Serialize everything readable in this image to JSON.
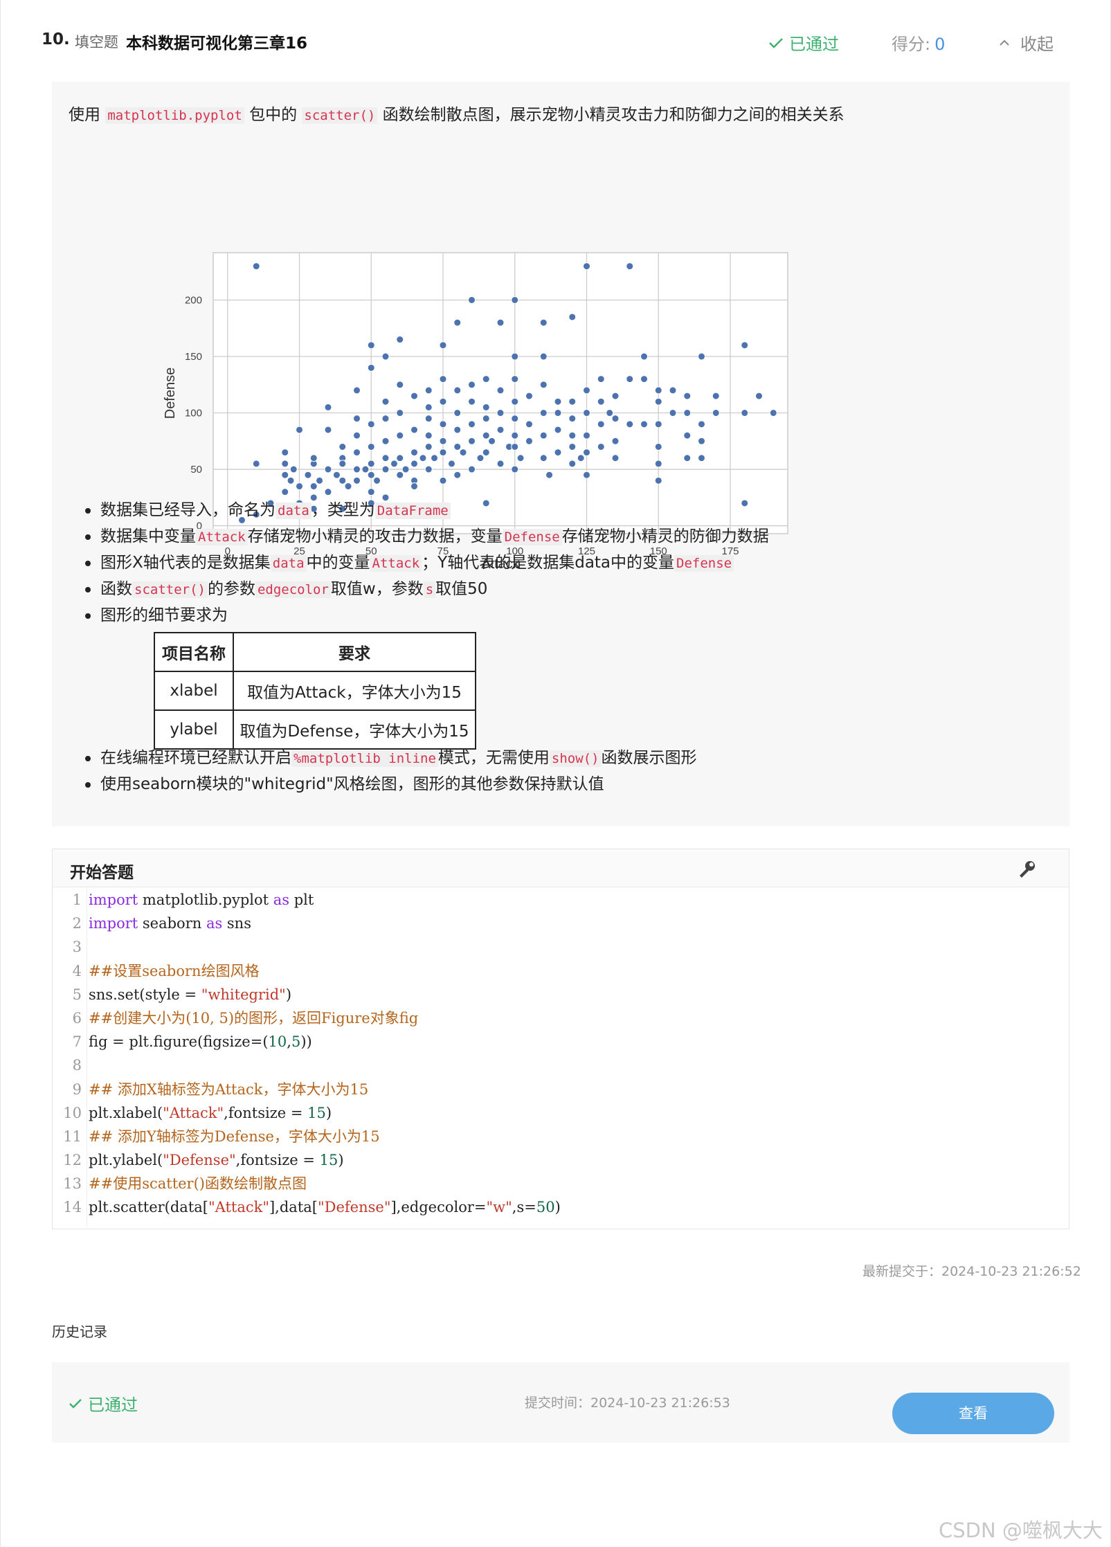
{
  "header": {
    "number": "10.",
    "type": "填空题",
    "title": "本科数据可视化第三章16",
    "status": "已通过",
    "score_label": "得分:",
    "score_value": "0",
    "collapse_label": "收起"
  },
  "description": {
    "intro": {
      "p1": "使用",
      "c1": "matplotlib.pyplot",
      "p2": "包中的",
      "c2": "scatter()",
      "p3": "函数绘制散点图，展示宠物小精灵攻击力和防御力之间的相关关系"
    },
    "bullets": [
      {
        "p1": "数据集已经导入，命名为",
        "c1": "data",
        "p2": "，类型为",
        "c2": "DataFrame"
      },
      {
        "p1": "数据集中变量",
        "c1": "Attack",
        "p2": "存储宠物小精灵的攻击力数据，变量",
        "c2": "Defense",
        "p3": "存储宠物小精灵的防御力数据"
      },
      {
        "p1": "图形X轴代表的是数据集",
        "c1": "data",
        "p2": "中的变量",
        "c2": "Attack",
        "p3": "；Y轴代表的是数据集data中的变量",
        "c3": "Defense"
      },
      {
        "p1": "函数",
        "c1": "scatter()",
        "p2": "的参数",
        "c2": "edgecolor",
        "p3": "取值w，参数",
        "c3": "s",
        "p4": "取值50"
      },
      {
        "p1": "图形的细节要求为"
      }
    ],
    "table": {
      "headers": [
        "项目名称",
        "要求"
      ],
      "rows": [
        [
          "xlabel",
          "取值为Attack，字体大小为15"
        ],
        [
          "ylabel",
          "取值为Defense，字体大小为15"
        ]
      ]
    },
    "bullets2": [
      {
        "p1": "在线编程环境已经默认开启",
        "c1": "%matplotlib inline",
        "p2": "模式，无需使用",
        "c2": "show()",
        "p3": "函数展示图形"
      },
      {
        "p1": "使用seaborn模块的\"whitegrid\"风格绘图，图形的其他参数保持默认值"
      }
    ]
  },
  "chart_data": {
    "type": "scatter",
    "xlabel": "Attack",
    "ylabel": "Defense",
    "xlim": [
      -5,
      195
    ],
    "ylim": [
      -7,
      242
    ],
    "xticks": [
      0,
      25,
      50,
      75,
      100,
      125,
      150,
      175
    ],
    "yticks": [
      0,
      50,
      100,
      150,
      200
    ],
    "grid": true,
    "marker_color": "#4c72b0",
    "edge_color": "#ffffff",
    "points": [
      [
        5,
        5
      ],
      [
        10,
        10
      ],
      [
        10,
        55
      ],
      [
        10,
        230
      ],
      [
        15,
        20
      ],
      [
        20,
        15
      ],
      [
        20,
        30
      ],
      [
        20,
        45
      ],
      [
        20,
        55
      ],
      [
        20,
        65
      ],
      [
        22,
        40
      ],
      [
        23,
        50
      ],
      [
        25,
        35
      ],
      [
        25,
        85
      ],
      [
        25,
        20
      ],
      [
        28,
        45
      ],
      [
        30,
        35
      ],
      [
        30,
        55
      ],
      [
        30,
        60
      ],
      [
        30,
        25
      ],
      [
        30,
        15
      ],
      [
        32,
        40
      ],
      [
        35,
        50
      ],
      [
        35,
        85
      ],
      [
        35,
        30
      ],
      [
        35,
        105
      ],
      [
        38,
        45
      ],
      [
        40,
        40
      ],
      [
        40,
        60
      ],
      [
        40,
        70
      ],
      [
        40,
        15
      ],
      [
        40,
        55
      ],
      [
        42,
        35
      ],
      [
        45,
        40
      ],
      [
        45,
        50
      ],
      [
        45,
        65
      ],
      [
        45,
        80
      ],
      [
        45,
        95
      ],
      [
        45,
        120
      ],
      [
        48,
        50
      ],
      [
        50,
        30
      ],
      [
        50,
        45
      ],
      [
        50,
        55
      ],
      [
        50,
        70
      ],
      [
        50,
        90
      ],
      [
        50,
        160
      ],
      [
        50,
        140
      ],
      [
        50,
        20
      ],
      [
        52,
        40
      ],
      [
        55,
        50
      ],
      [
        55,
        60
      ],
      [
        55,
        75
      ],
      [
        55,
        95
      ],
      [
        55,
        110
      ],
      [
        55,
        150
      ],
      [
        55,
        25
      ],
      [
        58,
        55
      ],
      [
        60,
        45
      ],
      [
        60,
        60
      ],
      [
        60,
        80
      ],
      [
        60,
        100
      ],
      [
        60,
        125
      ],
      [
        60,
        165
      ],
      [
        62,
        50
      ],
      [
        65,
        40
      ],
      [
        65,
        55
      ],
      [
        65,
        65
      ],
      [
        65,
        85
      ],
      [
        65,
        115
      ],
      [
        65,
        35
      ],
      [
        68,
        60
      ],
      [
        70,
        50
      ],
      [
        70,
        70
      ],
      [
        70,
        80
      ],
      [
        70,
        95
      ],
      [
        70,
        105
      ],
      [
        70,
        120
      ],
      [
        72,
        60
      ],
      [
        75,
        40
      ],
      [
        75,
        65
      ],
      [
        75,
        75
      ],
      [
        75,
        90
      ],
      [
        75,
        110
      ],
      [
        75,
        130
      ],
      [
        75,
        160
      ],
      [
        78,
        55
      ],
      [
        80,
        45
      ],
      [
        80,
        70
      ],
      [
        80,
        85
      ],
      [
        80,
        100
      ],
      [
        80,
        120
      ],
      [
        80,
        180
      ],
      [
        82,
        65
      ],
      [
        85,
        50
      ],
      [
        85,
        75
      ],
      [
        85,
        90
      ],
      [
        85,
        110
      ],
      [
        85,
        125
      ],
      [
        85,
        200
      ],
      [
        88,
        60
      ],
      [
        90,
        65
      ],
      [
        90,
        80
      ],
      [
        90,
        95
      ],
      [
        90,
        105
      ],
      [
        90,
        130
      ],
      [
        90,
        20
      ],
      [
        92,
        75
      ],
      [
        95,
        55
      ],
      [
        95,
        85
      ],
      [
        95,
        100
      ],
      [
        95,
        120
      ],
      [
        95,
        180
      ],
      [
        98,
        70
      ],
      [
        100,
        50
      ],
      [
        100,
        70
      ],
      [
        100,
        80
      ],
      [
        100,
        95
      ],
      [
        100,
        110
      ],
      [
        100,
        130
      ],
      [
        100,
        150
      ],
      [
        100,
        200
      ],
      [
        102,
        60
      ],
      [
        105,
        75
      ],
      [
        105,
        90
      ],
      [
        105,
        115
      ],
      [
        110,
        60
      ],
      [
        110,
        80
      ],
      [
        110,
        100
      ],
      [
        110,
        125
      ],
      [
        110,
        150
      ],
      [
        110,
        180
      ],
      [
        112,
        45
      ],
      [
        115,
        65
      ],
      [
        115,
        85
      ],
      [
        115,
        100
      ],
      [
        115,
        110
      ],
      [
        120,
        55
      ],
      [
        120,
        70
      ],
      [
        120,
        80
      ],
      [
        120,
        95
      ],
      [
        120,
        110
      ],
      [
        120,
        185
      ],
      [
        123,
        60
      ],
      [
        125,
        45
      ],
      [
        125,
        65
      ],
      [
        125,
        80
      ],
      [
        125,
        100
      ],
      [
        125,
        120
      ],
      [
        125,
        230
      ],
      [
        130,
        70
      ],
      [
        130,
        90
      ],
      [
        130,
        110
      ],
      [
        130,
        130
      ],
      [
        133,
        100
      ],
      [
        135,
        60
      ],
      [
        135,
        75
      ],
      [
        135,
        95
      ],
      [
        135,
        115
      ],
      [
        140,
        90
      ],
      [
        140,
        130
      ],
      [
        140,
        230
      ],
      [
        145,
        90
      ],
      [
        145,
        150
      ],
      [
        145,
        130
      ],
      [
        150,
        40
      ],
      [
        150,
        55
      ],
      [
        150,
        70
      ],
      [
        150,
        90
      ],
      [
        150,
        110
      ],
      [
        150,
        120
      ],
      [
        155,
        100
      ],
      [
        155,
        120
      ],
      [
        160,
        80
      ],
      [
        160,
        100
      ],
      [
        160,
        115
      ],
      [
        160,
        60
      ],
      [
        165,
        60
      ],
      [
        165,
        75
      ],
      [
        165,
        90
      ],
      [
        165,
        150
      ],
      [
        170,
        100
      ],
      [
        170,
        115
      ],
      [
        180,
        20
      ],
      [
        180,
        100
      ],
      [
        180,
        160
      ],
      [
        185,
        115
      ],
      [
        190,
        100
      ]
    ]
  },
  "answer": {
    "title": "开始答题",
    "lines": [
      [
        {
          "t": "import",
          "c": "kw"
        },
        {
          "t": " matplotlib.pyplot "
        },
        {
          "t": "as",
          "c": "kw"
        },
        {
          "t": " plt"
        }
      ],
      [
        {
          "t": "import",
          "c": "kw"
        },
        {
          "t": " seaborn "
        },
        {
          "t": "as",
          "c": "kw"
        },
        {
          "t": " sns"
        }
      ],
      [],
      [
        {
          "t": "##设置seaborn绘图风格",
          "c": "cm"
        }
      ],
      [
        {
          "t": "sns.set(style = "
        },
        {
          "t": "\"whitegrid\"",
          "c": "st"
        },
        {
          "t": ")"
        }
      ],
      [
        {
          "t": "##创建大小为(10, 5)的图形，返回Figure对象fig",
          "c": "cm"
        }
      ],
      [
        {
          "t": "fig = plt.figure(figsize=("
        },
        {
          "t": "10",
          "c": "nm"
        },
        {
          "t": ","
        },
        {
          "t": "5",
          "c": "nm"
        },
        {
          "t": "))"
        }
      ],
      [],
      [
        {
          "t": "## 添加X轴标签为Attack，字体大小为15",
          "c": "cm"
        }
      ],
      [
        {
          "t": "plt.xlabel("
        },
        {
          "t": "\"Attack\"",
          "c": "st"
        },
        {
          "t": ",fontsize = "
        },
        {
          "t": "15",
          "c": "nm"
        },
        {
          "t": ")"
        }
      ],
      [
        {
          "t": "## 添加Y轴标签为Defense，字体大小为15",
          "c": "cm"
        }
      ],
      [
        {
          "t": "plt.ylabel("
        },
        {
          "t": "\"Defense\"",
          "c": "st"
        },
        {
          "t": ",fontsize = "
        },
        {
          "t": "15",
          "c": "nm"
        },
        {
          "t": ")"
        }
      ],
      [
        {
          "t": "##使用scatter()函数绘制散点图",
          "c": "cm"
        }
      ],
      [
        {
          "t": "plt.scatter(data["
        },
        {
          "t": "\"Attack\"",
          "c": "st"
        },
        {
          "t": "],data["
        },
        {
          "t": "\"Defense\"",
          "c": "st"
        },
        {
          "t": "],edgecolor="
        },
        {
          "t": "\"w\"",
          "c": "st"
        },
        {
          "t": ",s="
        },
        {
          "t": "50",
          "c": "nm"
        },
        {
          "t": ")"
        }
      ]
    ]
  },
  "latest_submit": "最新提交于：2024-10-23 21:26:52",
  "history": {
    "label": "历史记录",
    "status": "已通过",
    "time": "提交时间：2024-10-23 21:26:53",
    "button": "查看"
  },
  "watermark": "CSDN @噬枫大大",
  "colors": {
    "pass_green": "#3db26e",
    "score_blue": "#4a90e2",
    "button_blue": "#5ba8e6",
    "code_red": "#d6334f"
  }
}
